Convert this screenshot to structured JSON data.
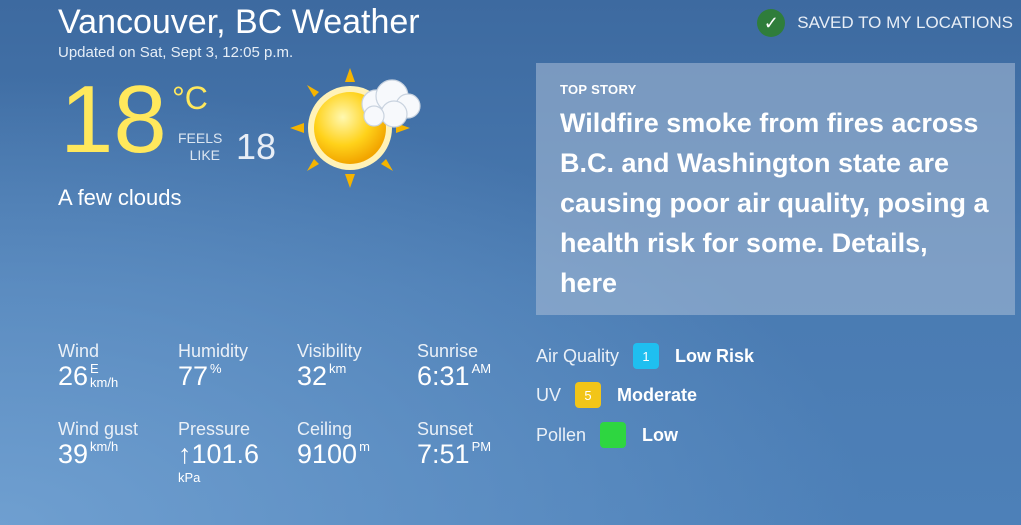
{
  "header": {
    "title": "Vancouver, BC Weather",
    "updated": "Updated on Sat, Sept 3, 12:05 p.m.",
    "saved_label": "SAVED TO MY LOCATIONS",
    "saved_icon": "checkmark-icon"
  },
  "current": {
    "temp": "18",
    "unit": "°C",
    "feels_label_1": "FEELS",
    "feels_label_2": "LIKE",
    "feels_value": "18",
    "condition": "A few clouds",
    "icon": "sun-cloud-icon"
  },
  "top_story": {
    "label": "TOP STORY",
    "text": "Wildfire smoke from fires across B.C. and Washington state are causing poor air quality, posing a health risk for some. Details, here"
  },
  "stats": {
    "wind": {
      "label": "Wind",
      "value": "26",
      "dir": "E",
      "unit": "km/h"
    },
    "humidity": {
      "label": "Humidity",
      "value": "77",
      "unit": "%"
    },
    "visibility": {
      "label": "Visibility",
      "value": "32",
      "unit": "km"
    },
    "sunrise": {
      "label": "Sunrise",
      "value": "6:31",
      "unit": "AM"
    },
    "wind_gust": {
      "label": "Wind gust",
      "value": "39",
      "unit": "km/h"
    },
    "pressure": {
      "label": "Pressure",
      "value": "↑101.6",
      "unit": "kPa"
    },
    "ceiling": {
      "label": "Ceiling",
      "value": "9100",
      "unit": "m"
    },
    "sunset": {
      "label": "Sunset",
      "value": "7:51",
      "unit": "PM"
    }
  },
  "indices": {
    "air_quality": {
      "label": "Air Quality",
      "badge": "1",
      "value": "Low Risk",
      "color": "#1fbff0"
    },
    "uv": {
      "label": "UV",
      "badge": "5",
      "value": "Moderate",
      "color": "#f2c518"
    },
    "pollen": {
      "label": "Pollen",
      "badge": "",
      "value": "Low",
      "color": "#2ed640"
    }
  }
}
